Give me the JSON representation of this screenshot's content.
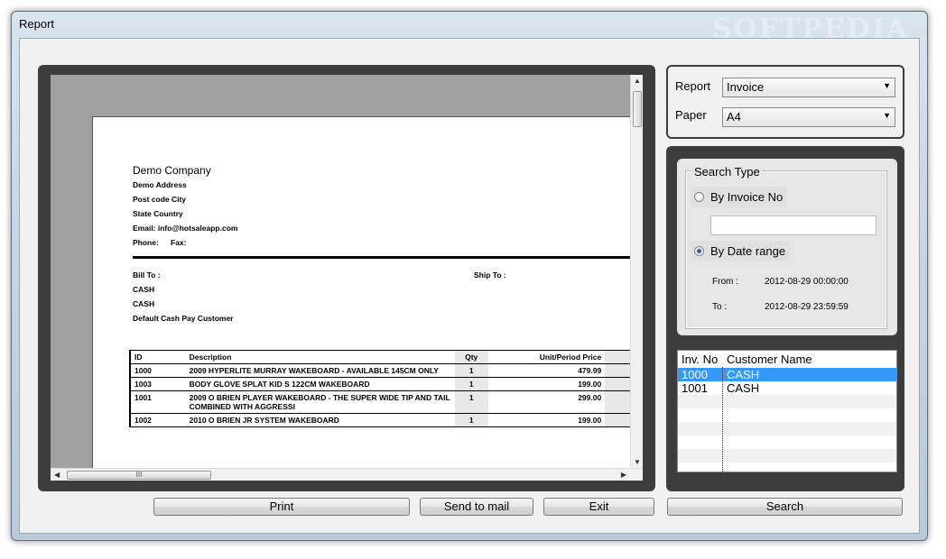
{
  "window": {
    "title": "Report",
    "watermark": "SOFTPEDIA"
  },
  "invoice": {
    "company": "Demo Company",
    "address": "Demo Address",
    "postcode": "Post code City",
    "state": "State Country",
    "email": "Email: info@hotsaleapp.com",
    "phone": "Phone:",
    "fax": "Fax:",
    "bill_to": "Bill To :",
    "ship_to": "Ship To :",
    "bill_lines": [
      "CASH",
      "CASH",
      "Default Cash Pay Customer"
    ],
    "columns": {
      "id": "ID",
      "description": "Description",
      "qty": "Qty",
      "price": "Unit/Period Price"
    },
    "rows": [
      {
        "id": "1000",
        "description": "2009 HYPERLITE MURRAY WAKEBOARD - AVAILABLE 145CM ONLY",
        "qty": "1",
        "price": "479.99"
      },
      {
        "id": "1003",
        "description": "BODY GLOVE SPLAT KID S 122CM WAKEBOARD",
        "qty": "1",
        "price": "199.00"
      },
      {
        "id": "1001",
        "description": "2009 O BRIEN PLAYER WAKEBOARD - THE SUPER WIDE TIP AND TAIL COMBINED WITH AGGRESSI",
        "qty": "1",
        "price": "299.00"
      },
      {
        "id": "1002",
        "description": "2010 O BRIEN JR SYSTEM WAKEBOARD",
        "qty": "1",
        "price": "199.00"
      }
    ]
  },
  "options": {
    "report_label": "Report",
    "report_value": "Invoice",
    "paper_label": "Paper",
    "paper_value": "A4"
  },
  "search": {
    "group_title": "Search Type",
    "by_invoice_label": "By Invoice No",
    "invoice_value": "",
    "by_date_label": "By Date range",
    "by_date_selected": true,
    "from_label": "From :",
    "from_value": "2012-08-29 00:00:00",
    "to_label": "To :",
    "to_value": "2012-08-29 23:59:59"
  },
  "results": {
    "col_inv": "Inv. No",
    "col_customer": "Customer Name",
    "rows": [
      {
        "inv": "1000",
        "customer": "CASH"
      },
      {
        "inv": "1001",
        "customer": "CASH"
      }
    ],
    "selected_index": 0
  },
  "buttons": {
    "print": "Print",
    "send_mail": "Send to mail",
    "exit": "Exit",
    "search": "Search"
  },
  "scroll": {
    "hthumb_label": "III"
  }
}
